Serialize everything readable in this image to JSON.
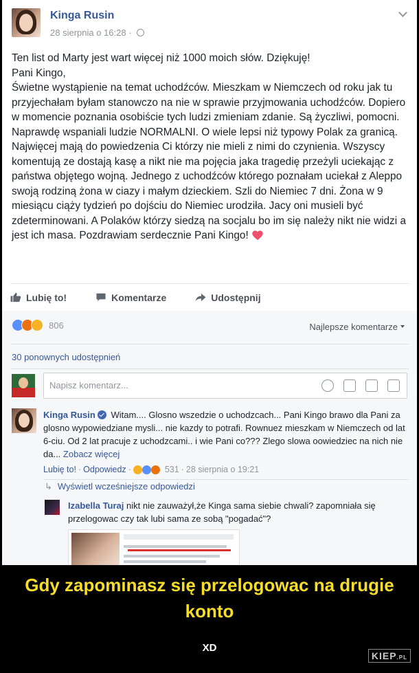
{
  "post": {
    "author": "Kinga Rusin",
    "date": "28 sierpnia o 16:28 · ",
    "text": [
      "Ten list od Marty jest wart więcej niż 1000 moich słów. Dziękuję!",
      "Pani Kingo,",
      "Świetne wystąpienie na temat uchodźców. Mieszkam w Niemczech od roku jak tu przyjechałam byłam stanowczo na nie w sprawie przyjmowania uchodźców. Dopiero w momencie poznania osobiście tych ludzi zmieniam zdanie. Są życzliwi, pomocni. Naprawdę wspaniali ludzie NORMALNI. O wiele lepsi niż typowy Polak za granicą. Najwięcej mają do powiedzenia Ci którzy nie mieli z nimi do czynienia. Wszyscy komentują ze dostają kasę a nikt nie ma pojęcia jaka tragedię przeżyli uciekając z państwa objętego wojną. Jednego z uchodźców którego poznałam uciekał z Aleppo swoją rodziną żona w ciazy i małym dzieckiem. Szli do Niemiec 7 dni. Żona w 9 miesiącu ciąży tydzień po dojściu do Niemiec urodziła. Jacy oni musieli być zdeterminowani. A Polaków którzy siedzą na socjalu bo im się należy nikt nie widzi a jest ich masa. Pozdrawiam serdecznie Pani Kingo!"
    ]
  },
  "actions": {
    "like": "Lubię to!",
    "comment": "Komentarze",
    "share": "Udostępnij"
  },
  "reactions": {
    "count": "806",
    "sort": "Najlepsze komentarze"
  },
  "shares": "30 ponownych udostępnień",
  "comment_input": {
    "placeholder": "Napisz komentarz..."
  },
  "comment": {
    "author": "Kinga Rusin",
    "text": "Witam.... Glosno wszedzie o uchodzcach... Pani Kingo brawo dla Pani za glosno wypowiedziane mysli... nie kazdy to potrafi. Rownuez mieszkam w Niemczech od lat 6-ciu. Od 2 lat pracuje z uchodzcami.. i wie Pani co??? Zlego slowa oowiedziec na nich nie da...",
    "see_more": "Zobacz więcej",
    "like": "Lubię to!",
    "reply": "Odpowiedz",
    "reaction_count": "531",
    "date": "28 sierpnia o 19:21"
  },
  "previous_replies": "Wyświetl wcześniejsze odpowiedzi",
  "reply": {
    "author": "Izabella Turaj",
    "text": "nikt nie zauważył,że Kinga sama siebie chwali? zapomniała się przelogowac czy tak lubi sama ze sobą \"pogadać\"?"
  },
  "caption": {
    "title": "Gdy zapominasz się przelogowac na drugie konto",
    "subtitle": "XD",
    "watermark_main": "KIEP",
    "watermark_suffix": ".PL"
  },
  "colors": {
    "link": "#365899",
    "caption": "#f6dd2a",
    "heart": "#f0506e"
  }
}
